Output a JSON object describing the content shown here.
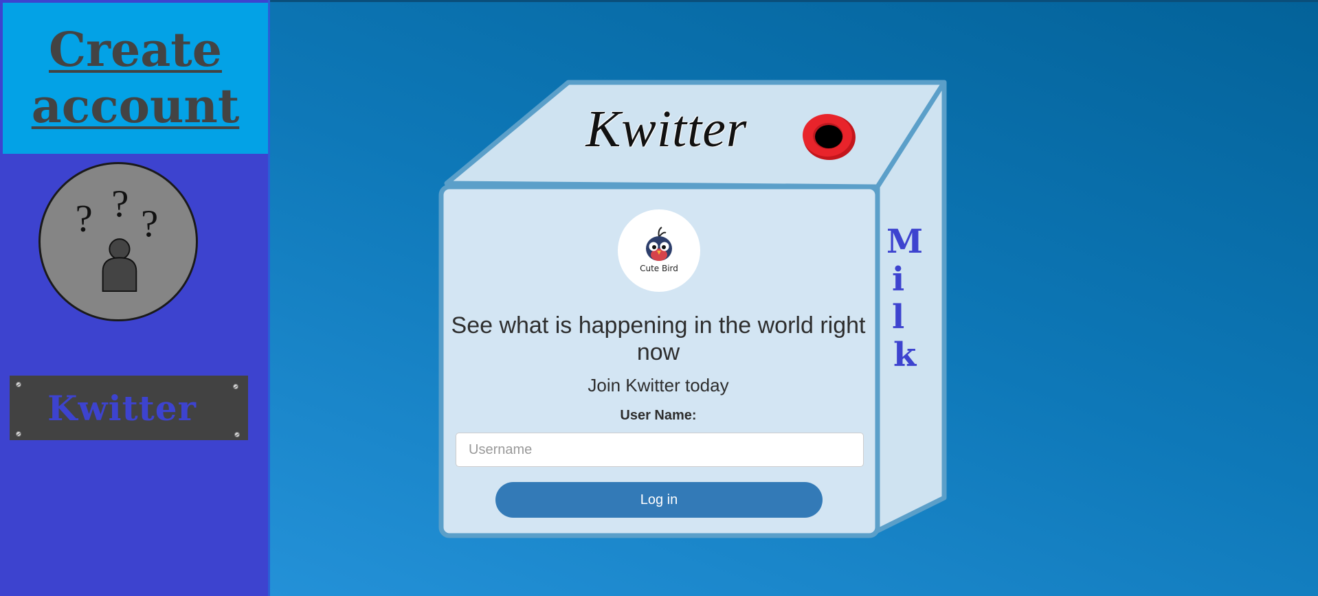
{
  "sidebar": {
    "create_account_label": "Create account",
    "plaque_label": "Kwitter"
  },
  "carton": {
    "top_title": "Kwitter",
    "side_text": [
      "M",
      "i",
      "l",
      "k"
    ]
  },
  "logo": {
    "caption": "Cute Bird",
    "icon": "cute-bird-logo"
  },
  "main": {
    "headline": "See what is happening in the world right now",
    "subheadline": "Join Kwitter today",
    "username_label": "User Name:",
    "username_placeholder": "Username",
    "username_value": "",
    "login_label": "Log in"
  },
  "colors": {
    "sidebar_bg": "#3d43cf",
    "create_box_bg": "#03a2e6",
    "carton_fill": "#cfe3f1",
    "carton_outline": "#5b9fc9",
    "button_bg": "#337ab7",
    "plaque_bg": "#424242"
  }
}
